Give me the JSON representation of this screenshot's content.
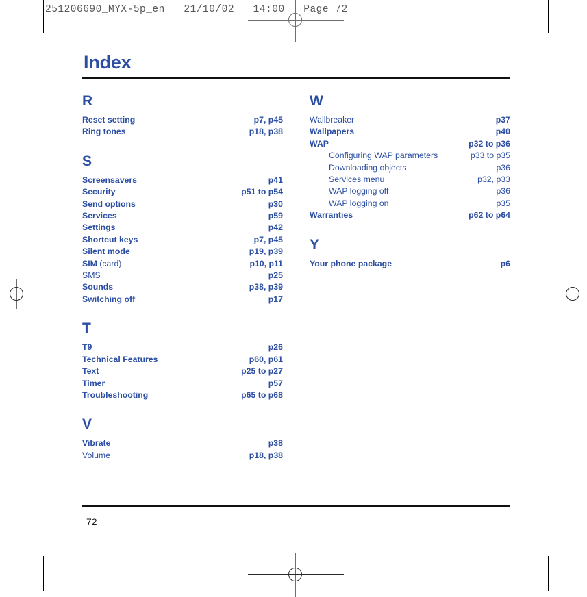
{
  "slug": {
    "text": "251206690_MYX-5p_en   21/10/02   14:00   Page 72"
  },
  "colors": {
    "accent_blue": "#2b4ea2",
    "rule_black": "#111111",
    "slug_gray": "#55575a"
  },
  "document": {
    "title": "Index",
    "folio": "72"
  },
  "columns": [
    {
      "groups": [
        {
          "letter": "R",
          "entries": [
            {
              "label": "Reset setting",
              "pages": "p7, p45",
              "style": "bold"
            },
            {
              "label": "Ring tones",
              "pages": "p18, p38",
              "style": "bold"
            }
          ]
        },
        {
          "letter": "S",
          "entries": [
            {
              "label": "Screensavers",
              "pages": "p41",
              "style": "bold"
            },
            {
              "label": "Security",
              "pages": "p51 to p54",
              "style": "bold"
            },
            {
              "label": "Send options",
              "pages": "p30",
              "style": "bold"
            },
            {
              "label": "Services",
              "pages": "p59",
              "style": "bold"
            },
            {
              "label": "Settings",
              "pages": "p42",
              "style": "bold"
            },
            {
              "label": "Shortcut keys",
              "pages": "p7, p45",
              "style": "bold"
            },
            {
              "label": "Silent mode",
              "pages": "p19, p39",
              "style": "bold"
            },
            {
              "label": "SIM",
              "label_suffix": " (card)",
              "pages": "p10, p11",
              "style": "bold-mixed"
            },
            {
              "label": "SMS",
              "pages": "p25",
              "style": "regular"
            },
            {
              "label": "Sounds",
              "pages": "p38, p39",
              "style": "bold"
            },
            {
              "label": "Switching off",
              "pages": "p17",
              "style": "bold"
            }
          ]
        },
        {
          "letter": "T",
          "entries": [
            {
              "label": "T9",
              "pages": "p26",
              "style": "bold"
            },
            {
              "label": "Technical Features",
              "pages": "p60, p61",
              "style": "bold"
            },
            {
              "label": "Text",
              "pages": "p25 to p27",
              "style": "bold"
            },
            {
              "label": "Timer",
              "pages": "p57",
              "style": "bold"
            },
            {
              "label": "Troubleshooting",
              "pages": "p65 to p68",
              "style": "bold"
            }
          ]
        },
        {
          "letter": "V",
          "entries": [
            {
              "label": "Vibrate",
              "pages": "p38",
              "style": "bold"
            },
            {
              "label": "Volume",
              "pages": "p18, p38",
              "style": "regular"
            }
          ]
        }
      ]
    },
    {
      "groups": [
        {
          "letter": "W",
          "entries": [
            {
              "label": "Wallbreaker",
              "pages": "p37",
              "style": "regular"
            },
            {
              "label": "Wallpapers",
              "pages": "p40",
              "style": "bold"
            },
            {
              "label": "WAP",
              "pages": "p32 to p36",
              "style": "bold"
            },
            {
              "label": "Configuring WAP parameters",
              "pages": "p33 to p35",
              "style": "sub"
            },
            {
              "label": "Downloading objects",
              "pages": "p36",
              "style": "sub"
            },
            {
              "label": "Services menu",
              "pages": "p32, p33",
              "style": "sub"
            },
            {
              "label": "WAP logging off",
              "pages": "p36",
              "style": "sub"
            },
            {
              "label": "WAP logging on",
              "pages": "p35",
              "style": "sub"
            },
            {
              "label": "Warranties",
              "pages": "p62 to p64",
              "style": "bold"
            }
          ]
        },
        {
          "letter": "Y",
          "entries": [
            {
              "label": "Your phone package",
              "pages": "p6",
              "style": "bold"
            }
          ]
        }
      ]
    }
  ]
}
